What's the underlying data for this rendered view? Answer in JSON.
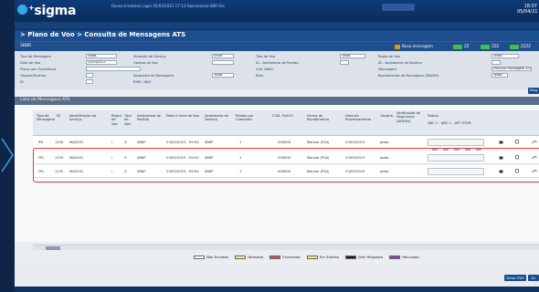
{
  "app": {
    "logo_text": "sigma",
    "logo_sup": "+",
    "top_info": "Decea  Iniciativa  Login  05/04/2021  17:13  Operacional  SBR  Ola",
    "clock_time": "18:07",
    "clock_sub": "05/04/21"
  },
  "menu": [
    "Início",
    "Plano de Voo",
    "Consulta de Mensagens",
    "Mensagens DEPR",
    "Gerenciar",
    "Configurações",
    "Sair"
  ],
  "page": {
    "title": "> Plano de Voo > Consulta de Mensagens ATS",
    "sub_label": "SBBR"
  },
  "top_legend": {
    "items": [
      {
        "label": "Nova mensagem",
        "color": "#e0a000"
      },
      {
        "label": "ZZ",
        "color": "#3fc23f"
      },
      {
        "label": "ZZZ",
        "color": "#3fc23f"
      },
      {
        "label": "ZZZZ",
        "color": "#3fc23f"
      }
    ]
  },
  "filters": {
    "tipo_mensagem_label": "Tipo de Mensagem",
    "tipo_mensagem_value": "Todos",
    "data_voo_label": "Data de Voo",
    "data_voo_value": "23/03/2023",
    "plano_ident_label": "Plano com Ocorrência",
    "origem_label": "Origem/Destino",
    "id_label": "ID",
    "situacao_label": "Situação do Serviço",
    "situacao_value": "Todos",
    "horario_voo_label": "Horário de Voo",
    "aeroporto_label": "Aeroporto de Mensagem",
    "aeroporto_value": "Todos",
    "rmk_label": "RMK / ANO",
    "status_label": "Status",
    "status_value": "Unico",
    "aeronave_label": "ID - Aeródromo de Partida",
    "cod_label": "Cod. ANAC",
    "rota_label": "Rota",
    "tipo_voo_label": "Tipo de Voo",
    "tipo_voo_value": "Todos",
    "aeroporto_destino_label": "ID - Aeródromo de Destino",
    "mensagem_label": "Mensagens",
    "mensagem_value": "Procurar mensagem ATS",
    "recebimento_label": "Recebimento de Mensagem (DD/HH)",
    "recebimento_value": "Todos",
    "regra_label": "Regra de Voo",
    "regra_value": "Todos",
    "tipo_ac_label": "Tipo de Aeronave",
    "tipo_ac_value": "Todos",
    "go_label": "Pesq"
  },
  "panel_title": "Lista de Mensagens ATS",
  "columns": [
    "Tipo de Mensagem",
    "ID",
    "Identificação do Serviço",
    "Regra de Voo",
    "Tipo de Voo",
    "Aeródromo de Partida",
    "Data e Hora de Voo",
    "Aeródromo de Destino",
    "Pilotos por Comando",
    "CÓD. FAACO",
    "Forma de Recebimento",
    "Data de Processamento",
    "Usuário",
    "Verificação de Segurança (DD/HH)",
    "Status",
    ""
  ],
  "status_sub": "ABC 1 - ABC 2 - APT STOR",
  "rows": [
    {
      "tipo": "RR",
      "id": "1234",
      "ident": "MAX201",
      "regra": "I",
      "tvoo": "G",
      "partida": "SBKP",
      "datahora": "23/03/2023 - 09:00",
      "destino": "SBSP",
      "pilotos": "1",
      "cod": "000000",
      "forma": "Manual (FSA)",
      "proc": "23/03/2023",
      "usuario": "plato"
    },
    {
      "tipo": "FPL",
      "id": "1233",
      "ident": "MAX201",
      "regra": "I",
      "tvoo": "G",
      "partida": "SBKP",
      "datahora": "23/03/2023 - 09:00",
      "destino": "SBSP",
      "pilotos": "1",
      "cod": "000000",
      "forma": "Manual (FSA)",
      "proc": "23/03/2023",
      "usuario": "plato"
    },
    {
      "tipo": "FPL",
      "id": "1232",
      "ident": "MAX201",
      "regra": "I",
      "tvoo": "G",
      "partida": "SBKP",
      "datahora": "23/03/2023 - 09:00",
      "destino": "SBSP",
      "pilotos": "1",
      "cod": "000000",
      "forma": "Manual (FSA)",
      "proc": "23/03/2023",
      "usuario": "plato"
    }
  ],
  "bottom_legend": [
    {
      "label": "Não Enviada",
      "color": "#ffffff"
    },
    {
      "label": "Atrasada",
      "color": "#ffe98a"
    },
    {
      "label": "Encerrada",
      "color": "#e44848"
    },
    {
      "label": "Em Análise",
      "color": "#f6f06a"
    },
    {
      "label": "Sem Resposta",
      "color": "#222222"
    },
    {
      "label": "Recusada",
      "color": "#9a3cc4"
    }
  ],
  "footer": {
    "btn1": "Gerar PDF",
    "btn2": "Ex"
  }
}
